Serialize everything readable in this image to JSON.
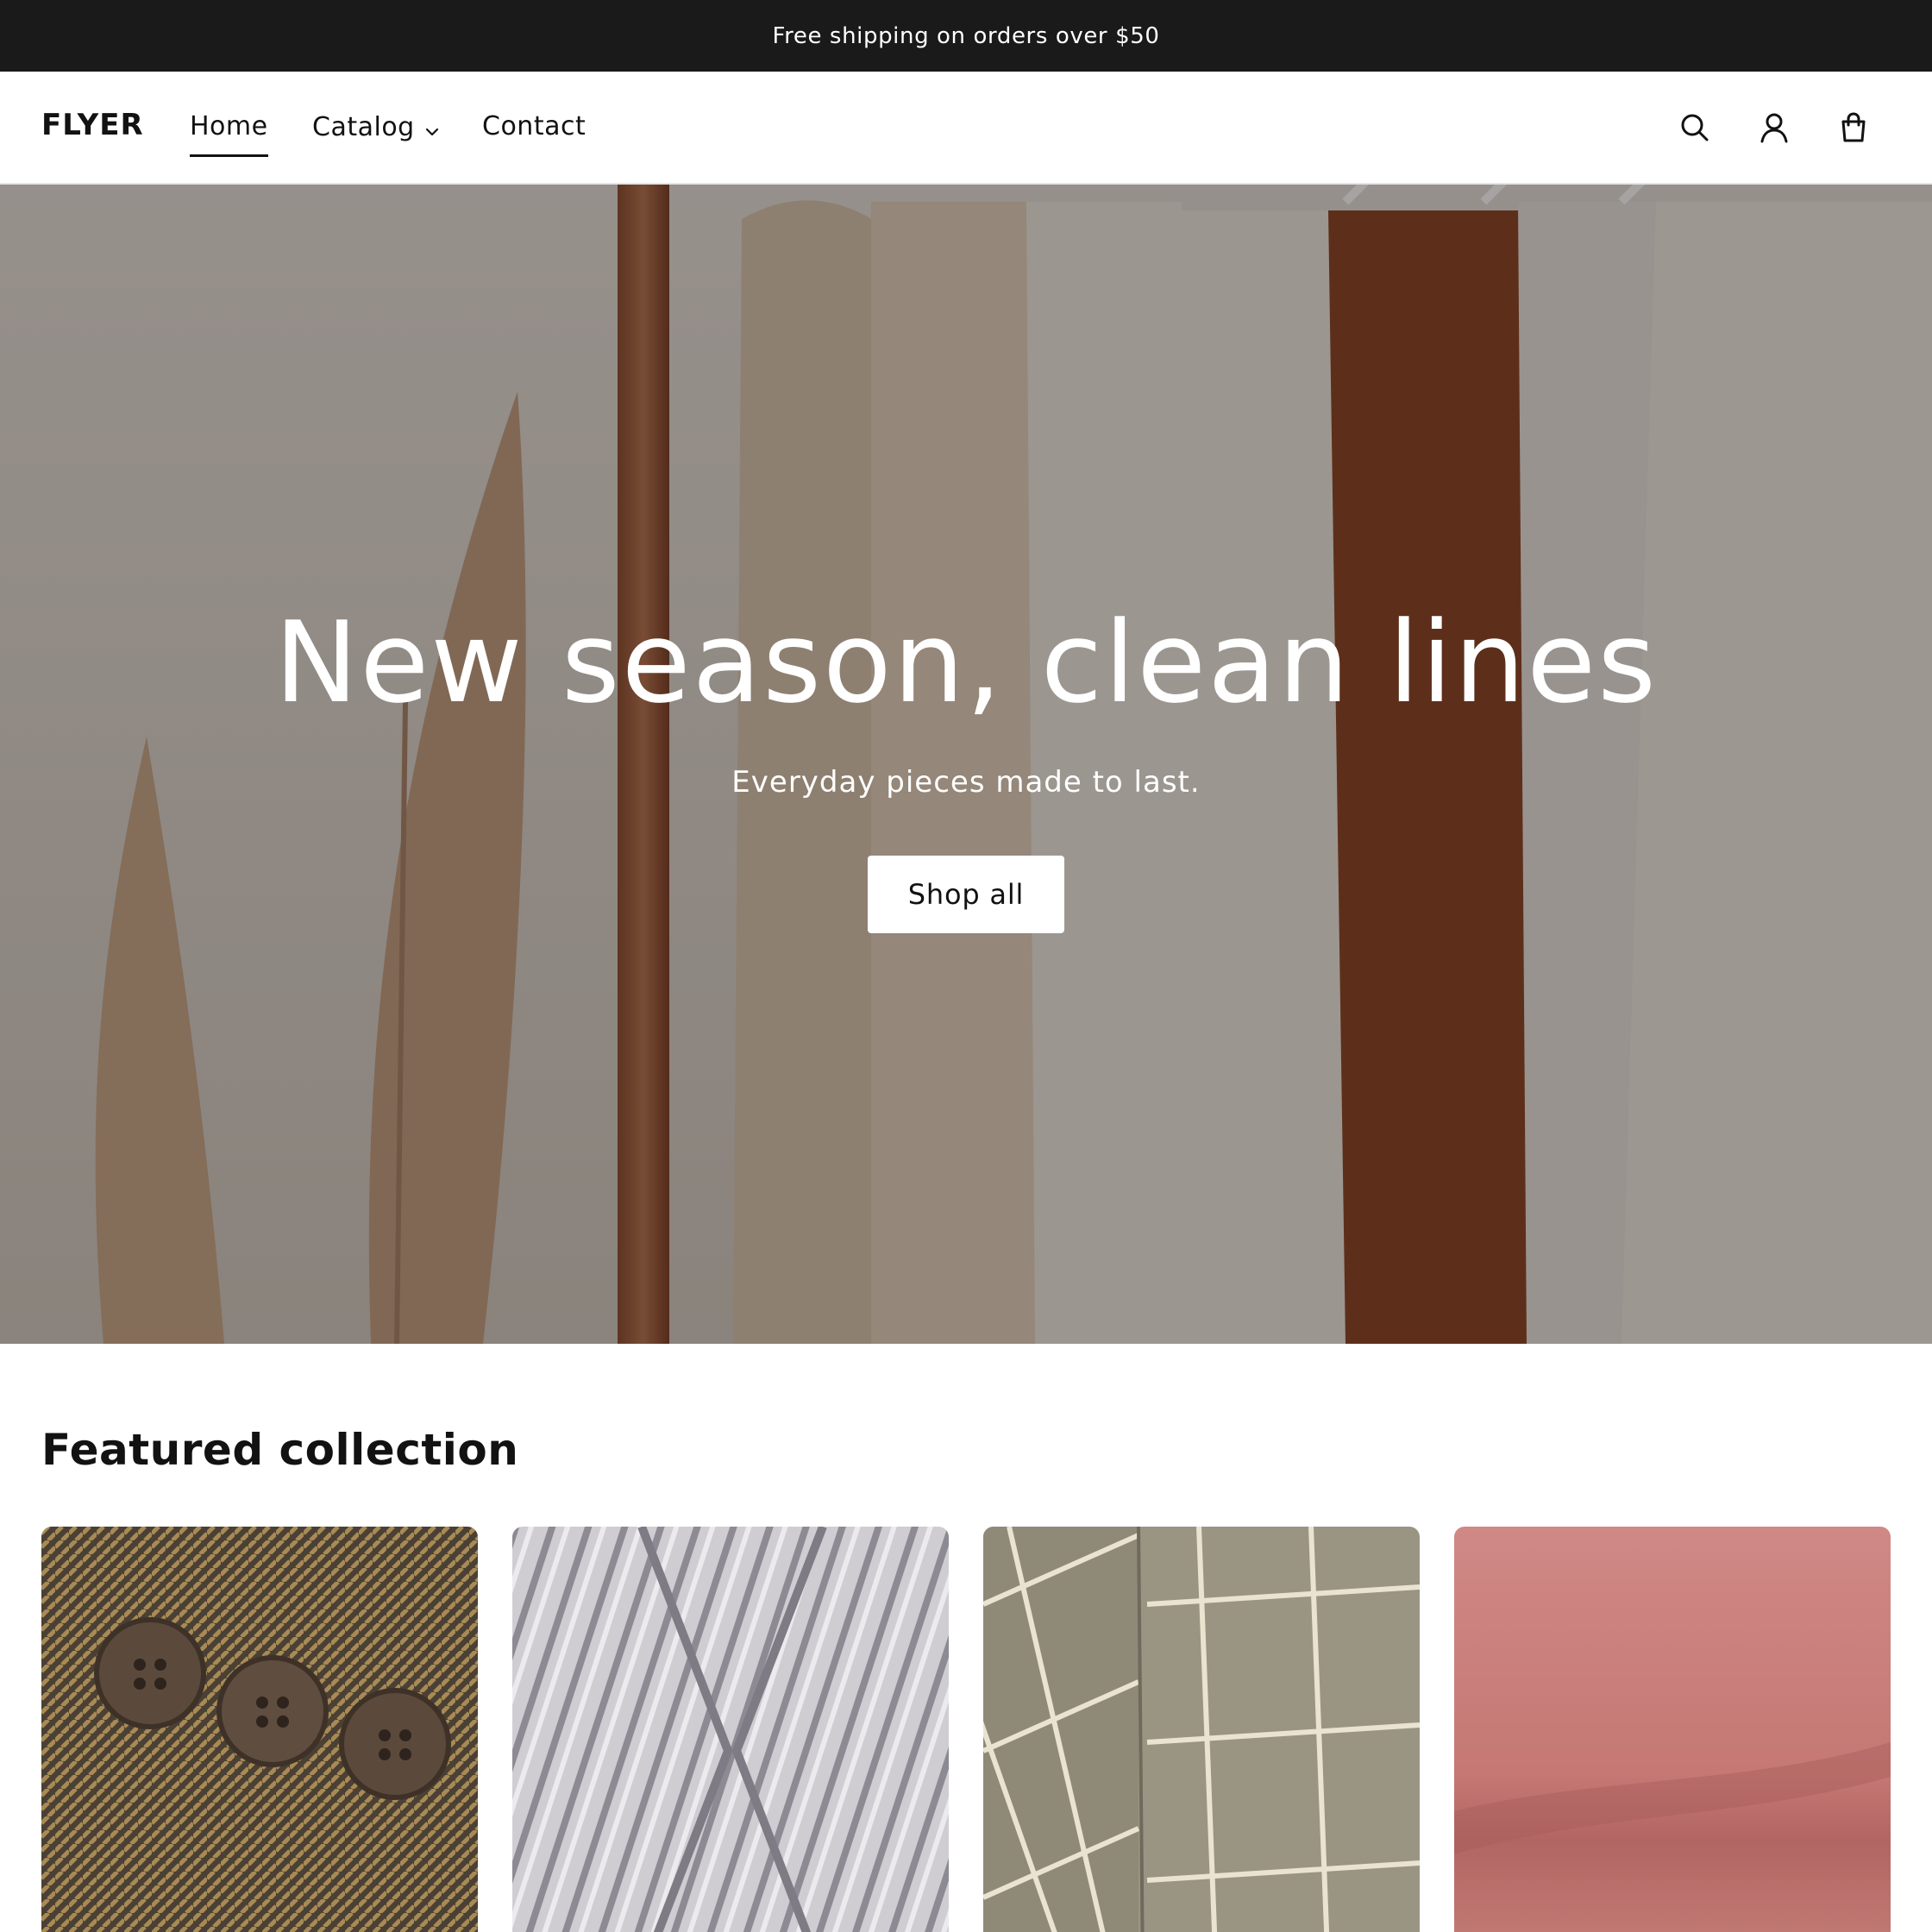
{
  "announcement": {
    "text": "Free shipping on orders over $50"
  },
  "header": {
    "logo": "FLYER",
    "nav": [
      {
        "label": "Home",
        "active": true
      },
      {
        "label": "Catalog",
        "has_dropdown": true
      },
      {
        "label": "Contact"
      }
    ],
    "icons": [
      "search-icon",
      "account-icon",
      "cart-icon"
    ]
  },
  "hero": {
    "title": "New season, clean lines",
    "subtitle": "Everyday pieces made to last.",
    "button_label": "Shop all"
  },
  "featured": {
    "title": "Featured collection",
    "products": [
      {
        "image": "tweed-fabric-with-buttons"
      },
      {
        "image": "white-cotton-rope-skein"
      },
      {
        "image": "grid-pattern-fabric"
      },
      {
        "image": "pink-flannel-fabric"
      }
    ]
  },
  "colors": {
    "announcement_bg": "#1a1a1a",
    "text": "#121212",
    "button_bg": "#ffffff"
  }
}
